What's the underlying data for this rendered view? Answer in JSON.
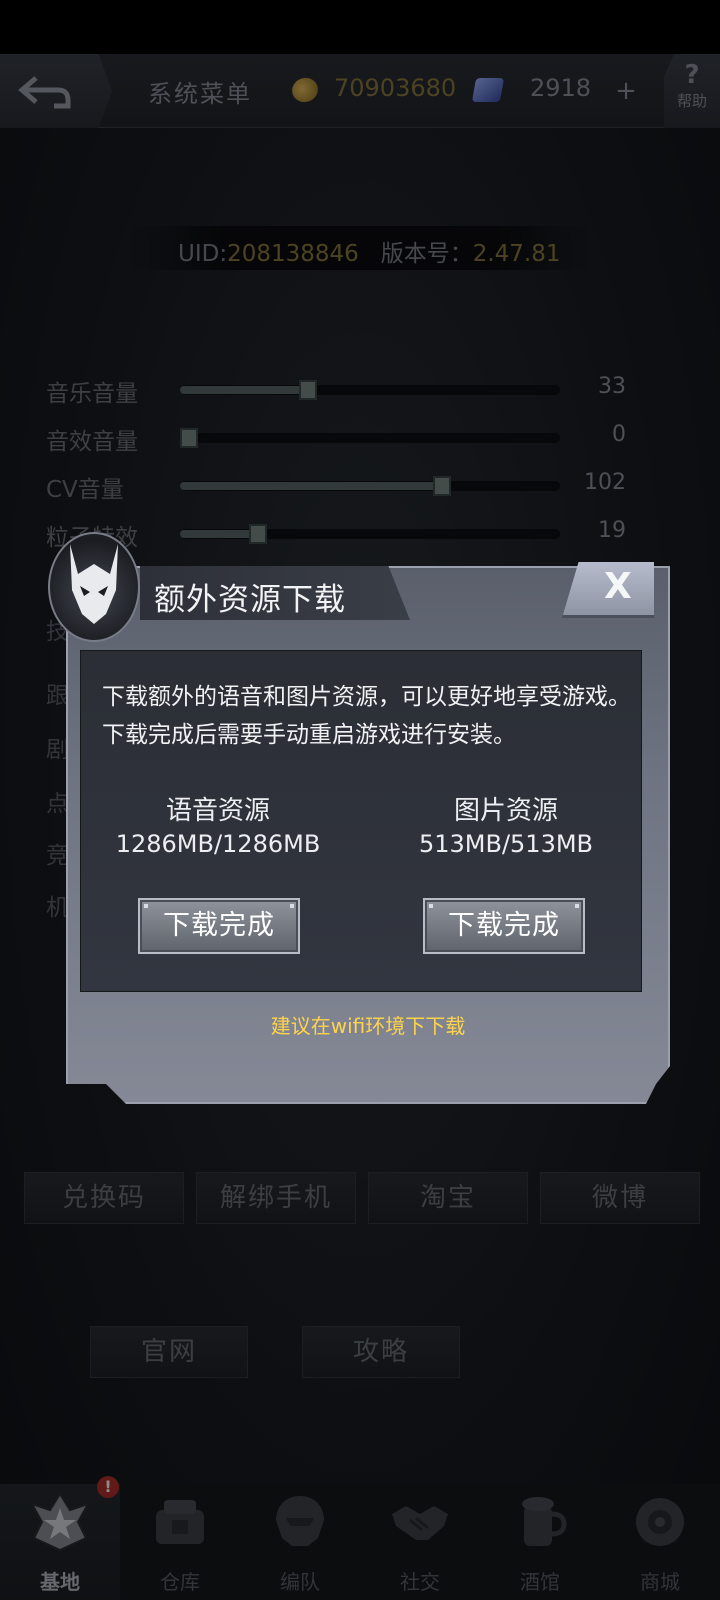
{
  "header": {
    "title": "系统菜单",
    "coins": "70903680",
    "gems": "2918",
    "plus_label": "+",
    "help_symbol": "?",
    "help_label": "帮助"
  },
  "account": {
    "uid_label": "UID:",
    "uid_value": "208138846",
    "version_label": "版本号：",
    "version_value": "2.47.81"
  },
  "settings": [
    {
      "label": "音乐音量",
      "value": "33",
      "percent": 33
    },
    {
      "label": "音效音量",
      "value": "0",
      "percent": 0
    },
    {
      "label": "CV音量",
      "value": "102",
      "percent": 70
    },
    {
      "label": "粒子特效",
      "value": "19",
      "percent": 19
    }
  ],
  "menu_partial": [
    "技",
    "跟",
    "剧",
    "点",
    "竞",
    "机"
  ],
  "bottom_buttons": [
    "兑换码",
    "解绑手机",
    "淘宝",
    "微博",
    "官网",
    "攻略"
  ],
  "nav": [
    {
      "label": "基地",
      "icon": "base-emblem-icon",
      "active": true
    },
    {
      "label": "仓库",
      "icon": "warehouse-icon",
      "active": false
    },
    {
      "label": "编队",
      "icon": "formation-icon",
      "active": false
    },
    {
      "label": "社交",
      "icon": "handshake-icon",
      "active": false
    },
    {
      "label": "酒馆",
      "icon": "tavern-icon",
      "active": false
    },
    {
      "label": "商城",
      "icon": "shop-icon",
      "active": false
    }
  ],
  "nav_badge": "!",
  "dialog": {
    "title": "额外资源下载",
    "close_label": "X",
    "description": "下载额外的语音和图片资源，可以更好地享受游戏。下载完成后需要手动重启游戏进行安装。",
    "resources": [
      {
        "name": "语音资源",
        "size": "1286MB/1286MB",
        "button": "下载完成"
      },
      {
        "name": "图片资源",
        "size": "513MB/513MB",
        "button": "下载完成"
      }
    ],
    "hint": "建议在wifi环境下下载"
  },
  "colors": {
    "accent_gold": "#8a7a3e",
    "hint_yellow": "#ffd34a",
    "badge_red": "#b3302e"
  }
}
